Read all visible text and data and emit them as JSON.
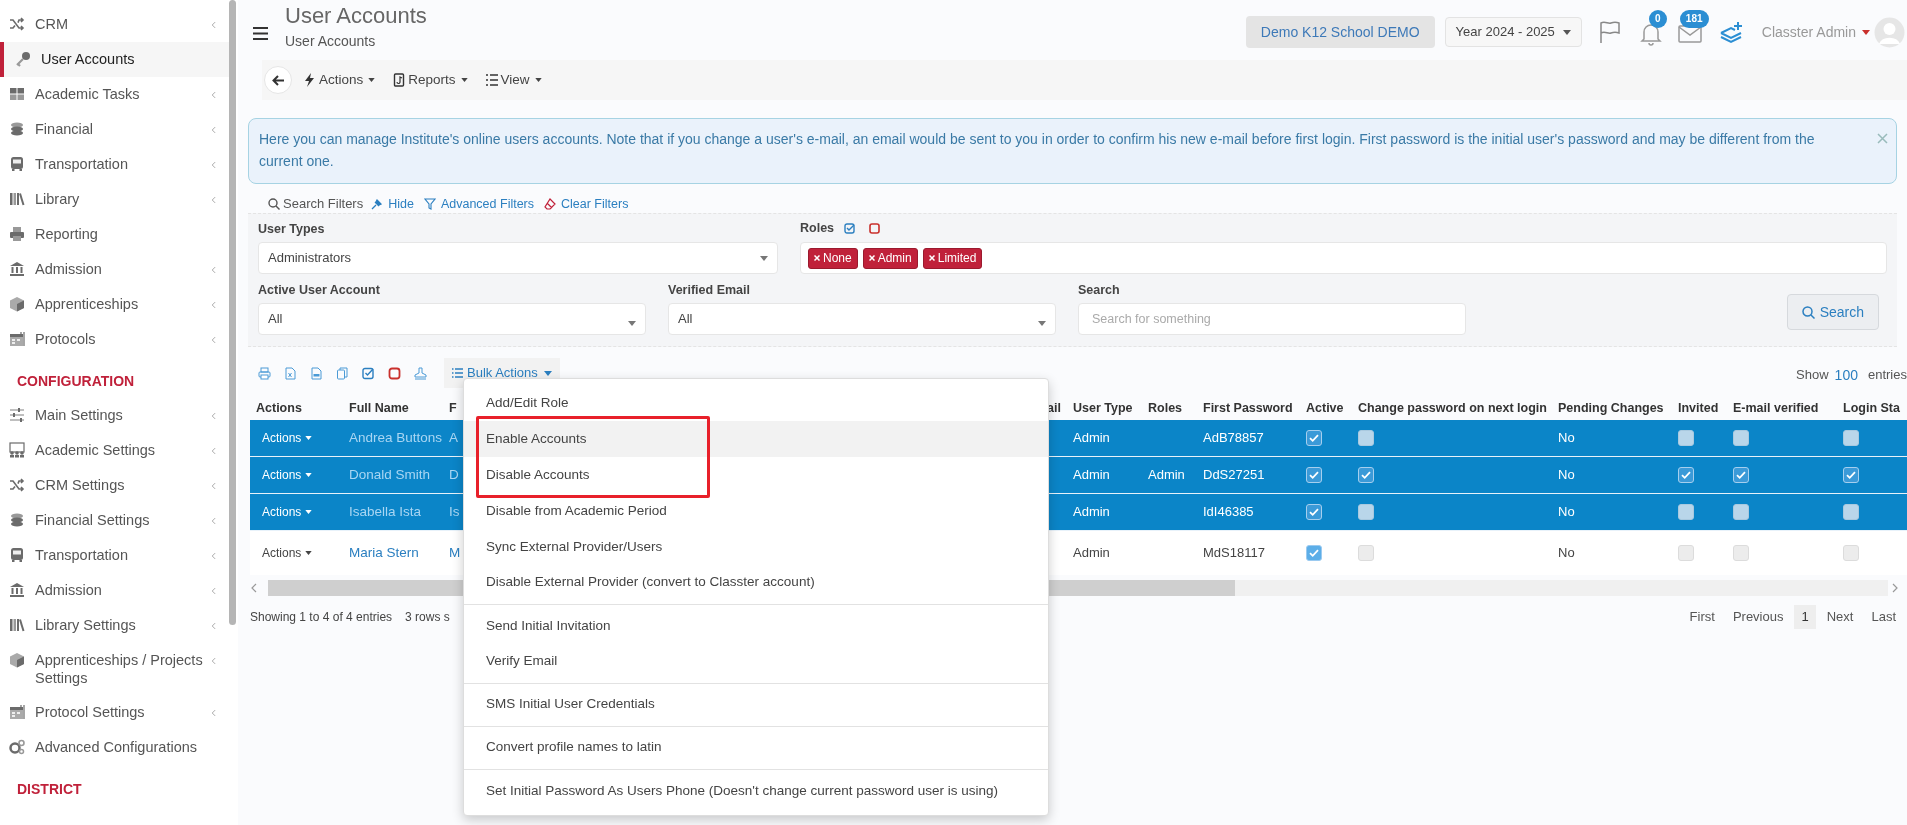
{
  "sidebar": {
    "items": [
      {
        "kind": "item",
        "label": "CRM",
        "expandable": true,
        "selected": false
      },
      {
        "kind": "item",
        "label": "User Accounts",
        "expandable": false,
        "selected": true
      },
      {
        "kind": "item",
        "label": "Academic Tasks",
        "expandable": true,
        "selected": false
      },
      {
        "kind": "item",
        "label": "Financial",
        "expandable": true,
        "selected": false
      },
      {
        "kind": "item",
        "label": "Transportation",
        "expandable": true,
        "selected": false
      },
      {
        "kind": "item",
        "label": "Library",
        "expandable": true,
        "selected": false
      },
      {
        "kind": "item",
        "label": "Reporting",
        "expandable": false,
        "selected": false
      },
      {
        "kind": "item",
        "label": "Admission",
        "expandable": true,
        "selected": false
      },
      {
        "kind": "item",
        "label": "Apprenticeships",
        "expandable": true,
        "selected": false
      },
      {
        "kind": "item",
        "label": "Protocols",
        "expandable": true,
        "selected": false
      },
      {
        "kind": "heading",
        "label": "CONFIGURATION"
      },
      {
        "kind": "item",
        "label": "Main Settings",
        "expandable": true,
        "selected": false
      },
      {
        "kind": "item",
        "label": "Academic Settings",
        "expandable": true,
        "selected": false
      },
      {
        "kind": "item",
        "label": "CRM Settings",
        "expandable": true,
        "selected": false
      },
      {
        "kind": "item",
        "label": "Financial Settings",
        "expandable": true,
        "selected": false
      },
      {
        "kind": "item",
        "label": "Transportation",
        "expandable": true,
        "selected": false
      },
      {
        "kind": "item",
        "label": "Admission",
        "expandable": true,
        "selected": false
      },
      {
        "kind": "item",
        "label": "Library Settings",
        "expandable": true,
        "selected": false
      },
      {
        "kind": "item",
        "label": "Apprenticeships / Projects Settings",
        "expandable": true,
        "selected": false
      },
      {
        "kind": "item",
        "label": "Protocol Settings",
        "expandable": true,
        "selected": false
      },
      {
        "kind": "item",
        "label": "Advanced Configurations",
        "expandable": false,
        "selected": false
      },
      {
        "kind": "heading",
        "label": "DISTRICT"
      }
    ]
  },
  "header": {
    "title": "User Accounts",
    "subtitle": "User Accounts",
    "school": "Demo K12 School DEMO",
    "year": "Year 2024 - 2025",
    "notifications": "0",
    "messages": "181",
    "user": "Classter Admin"
  },
  "toolbar": {
    "buttons": [
      "Actions",
      "Reports",
      "View"
    ]
  },
  "alert": {
    "text": "Here you can manage Institute's online users accounts. Note that if you change a user's e-mail, an email would be sent to you in order to confirm his new e-mail before first login. First password is the initial user's password and may be different from the current one."
  },
  "filters": {
    "title": "Search Filters",
    "links": [
      "Hide",
      "Advanced Filters",
      "Clear Filters"
    ],
    "user_types": {
      "label": "User Types",
      "value": "Administrators"
    },
    "roles": {
      "label": "Roles",
      "tags": [
        "None",
        "Admin",
        "Limited"
      ]
    },
    "active_user_account": {
      "label": "Active User Account",
      "value": "All"
    },
    "verified_email": {
      "label": "Verified Email",
      "value": "All"
    },
    "search": {
      "label": "Search",
      "placeholder": "Search for something"
    },
    "search_button": "Search"
  },
  "table_toolbar": {
    "bulk_actions": "Bulk Actions",
    "show_label": "Show",
    "page_size": "100",
    "entries_label": "entries"
  },
  "table": {
    "columns": [
      "Actions",
      "Full Name",
      "F",
      "ail",
      "User Type",
      "Roles",
      "First Password",
      "Active",
      "Change password on next login",
      "Pending Changes",
      "Invited",
      "E-mail verified",
      "Login Sta"
    ],
    "rows": [
      {
        "selected": true,
        "actions": "Actions",
        "full_name": "Andrea Buttons",
        "column_3": "A",
        "user_type": "Admin",
        "first_password": "AdB78857",
        "active": true,
        "change_password": false,
        "pending_changes": "No",
        "invited": false,
        "email_verified": false,
        "login_status": false
      },
      {
        "selected": true,
        "actions": "Actions",
        "full_name": "Donald Smith",
        "column_3": "D",
        "user_type": "Admin",
        "roles": "Admin",
        "first_password": "DdS27251",
        "active": true,
        "change_password": true,
        "pending_changes": "No",
        "invited": true,
        "email_verified": true,
        "login_status": true
      },
      {
        "selected": true,
        "actions": "Actions",
        "full_name": "Isabella Ista",
        "column_3": "Is",
        "user_type": "Admin",
        "first_password": "IdI46385",
        "active": true,
        "change_password": false,
        "pending_changes": "No",
        "invited": false,
        "email_verified": false,
        "login_status": false
      },
      {
        "selected": false,
        "actions": "Actions",
        "full_name": "Maria Stern",
        "column_3": "M",
        "user_type": "Admin",
        "first_password": "MdS18117",
        "active": true,
        "change_password": false,
        "pending_changes": "No",
        "invited": false,
        "email_verified": false,
        "login_status": false
      }
    ]
  },
  "footer": {
    "info": "Showing 1 to 4 of 4 entries",
    "selection": "3 rows s",
    "pagination": [
      {
        "label": "First",
        "selected": false
      },
      {
        "label": "Previous",
        "selected": false
      },
      {
        "label": "1",
        "selected": true
      },
      {
        "label": "Next",
        "selected": false
      },
      {
        "label": "Last",
        "selected": false
      }
    ]
  },
  "bulk_menu": {
    "items": [
      {
        "label": "Add/Edit Role",
        "highlighted": false,
        "in_red_box": false,
        "divider_after": false
      },
      {
        "label": "Enable Accounts",
        "highlighted": true,
        "in_red_box": true,
        "divider_after": false
      },
      {
        "label": "Disable Accounts",
        "highlighted": false,
        "in_red_box": true,
        "divider_after": false
      },
      {
        "label": "Disable from Academic Period",
        "highlighted": false,
        "in_red_box": false,
        "divider_after": false
      },
      {
        "label": "Sync External Provider/Users",
        "highlighted": false,
        "in_red_box": false,
        "divider_after": false
      },
      {
        "label": "Disable External Provider (convert to Classter account)",
        "highlighted": false,
        "in_red_box": false,
        "divider_after": true
      },
      {
        "label": "Send Initial Invitation",
        "highlighted": false,
        "in_red_box": false,
        "divider_after": false
      },
      {
        "label": "Verify Email",
        "highlighted": false,
        "in_red_box": false,
        "divider_after": true
      },
      {
        "label": "SMS Initial User Credentials",
        "highlighted": false,
        "in_red_box": false,
        "divider_after": true
      },
      {
        "label": "Convert profile names to latin",
        "highlighted": false,
        "in_red_box": false,
        "divider_after": true
      },
      {
        "label": "Set Initial Password As Users Phone (Doesn't change current password user is using)",
        "highlighted": false,
        "in_red_box": false,
        "divider_after": false
      }
    ]
  }
}
